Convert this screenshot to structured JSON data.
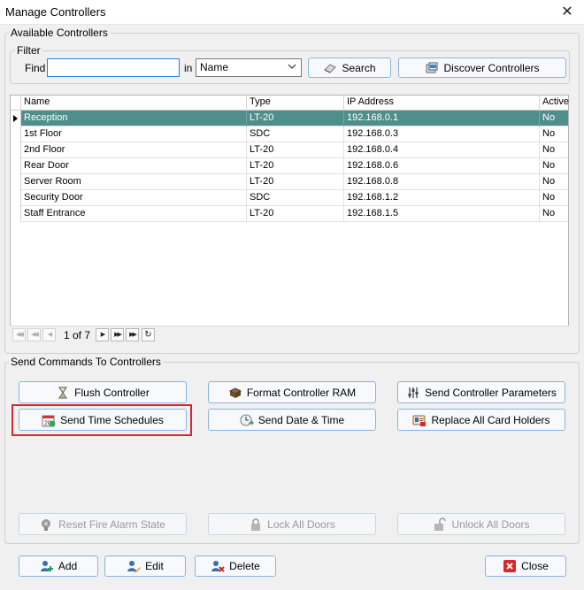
{
  "window": {
    "title": "Manage Controllers",
    "close_glyph": "✕"
  },
  "available": {
    "legend": "Available Controllers",
    "filter": {
      "legend": "Filter",
      "find_label": "Find",
      "find_value": "",
      "in_label": "in",
      "field_selected": "Name",
      "search_label": "Search",
      "discover_label": "Discover Controllers"
    },
    "columns": [
      "Name",
      "Type",
      "IP Address",
      "Active"
    ],
    "rows": [
      {
        "name": "Reception",
        "type": "LT-20",
        "ip": "192.168.0.1",
        "active": "No",
        "selected": true
      },
      {
        "name": "1st Floor",
        "type": "SDC",
        "ip": "192.168.0.3",
        "active": "No"
      },
      {
        "name": "2nd Floor",
        "type": "LT-20",
        "ip": "192.168.0.4",
        "active": "No"
      },
      {
        "name": "Rear Door",
        "type": "LT-20",
        "ip": "192.168.0.6",
        "active": "No"
      },
      {
        "name": "Server Room",
        "type": "LT-20",
        "ip": "192.168.0.8",
        "active": "No"
      },
      {
        "name": "Security Door",
        "type": "SDC",
        "ip": "192.168.1.2",
        "active": "No"
      },
      {
        "name": "Staff Entrance",
        "type": "LT-20",
        "ip": "192.168.1.5",
        "active": "No"
      }
    ],
    "pager": {
      "text": "1 of 7"
    }
  },
  "commands": {
    "legend": "Send Commands To Controllers",
    "flush": "Flush Controller",
    "format_ram": "Format Controller RAM",
    "send_params": "Send Controller Parameters",
    "send_schedules": "Send Time Schedules",
    "send_datetime": "Send Date & Time",
    "replace_cardholders": "Replace All Card Holders",
    "reset_fire": "Reset Fire Alarm State",
    "lock_all": "Lock All Doors",
    "unlock_all": "Unlock All Doors"
  },
  "footer": {
    "add": "Add",
    "edit": "Edit",
    "delete": "Delete",
    "close": "Close"
  },
  "colors": {
    "selection": "#4f8f8b",
    "highlight": "#d9262c",
    "button_border": "#8bb4de"
  }
}
